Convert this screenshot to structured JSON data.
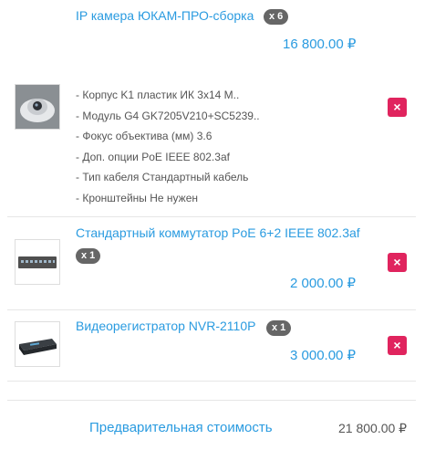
{
  "cart": {
    "items": [
      {
        "title": "IP камера ЮКАМ-ПРО-сборка",
        "quantity": "x 6",
        "price": "16 800.00 ₽",
        "thumbnail": "dome-camera-image",
        "options": [
          "- Корпус K1 пластик ИК 3x14 М..",
          "- Модуль G4 GK7205V210+SC5239..",
          "- Фокус объектива (мм) 3.6",
          "- Доп. опции PoE IEEE 802.3af",
          "- Тип кабеля Стандартный кабель",
          "- Кронштейны Не нужен"
        ]
      },
      {
        "title": "Стандартный коммутатор PoE 6+2 IEEE 802.3af",
        "quantity": "x 1",
        "price": "2 000.00 ₽",
        "thumbnail": "network-switch-image"
      },
      {
        "title": "Видеорегистратор NVR-2110P",
        "quantity": "x 1",
        "price": "3 000.00 ₽",
        "thumbnail": "nvr-recorder-image"
      }
    ],
    "remove_icon": "×",
    "summary": {
      "label": "Предварительная стоимость",
      "value": "21 800.00 ₽"
    }
  },
  "colors": {
    "accent": "#2a9be0",
    "remove": "#e0245e",
    "badge": "#666666"
  }
}
